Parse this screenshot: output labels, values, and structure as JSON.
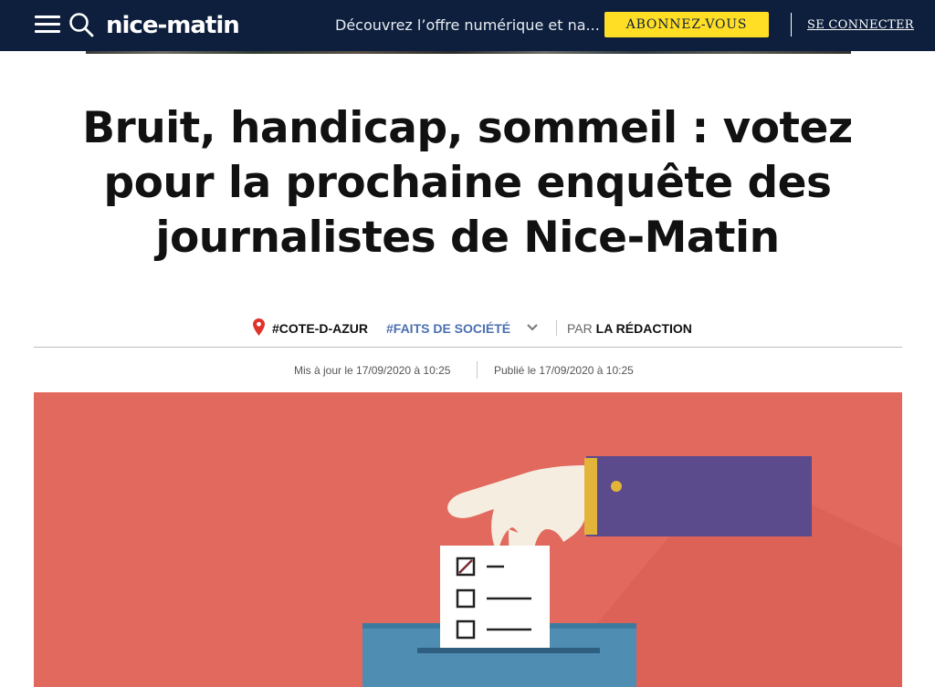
{
  "header": {
    "logo": "nice-matin",
    "promo_text": "Découvrez l’offre numérique et na...",
    "subscribe_label": "ABONNEZ-VOUS",
    "login_label": "SE CONNECTER",
    "colors": {
      "bar": "#0d1f3c",
      "subscribe_bg": "#ffde25"
    }
  },
  "article": {
    "title": "Bruit, handicap, sommeil : votez pour la prochaine enquête des journalistes de Nice-Matin",
    "tags": [
      "#COTE-D-AZUR",
      "#FAITS DE SOCIÉTÉ"
    ],
    "author_prefix": "PAR",
    "author": "LA RÉDACTION",
    "updated": "Mis à jour le 17/09/2020 à 10:25",
    "published": "Publié le 17/09/2020 à 10:25",
    "icons": {
      "location": "map-pin-icon",
      "expand": "chevron-down-icon",
      "menu": "hamburger-menu-icon",
      "search": "search-icon"
    },
    "colors": {
      "tag_link": "#4a6fb0",
      "pin": "#e0332b",
      "hero_bg": "#e2695e"
    }
  }
}
